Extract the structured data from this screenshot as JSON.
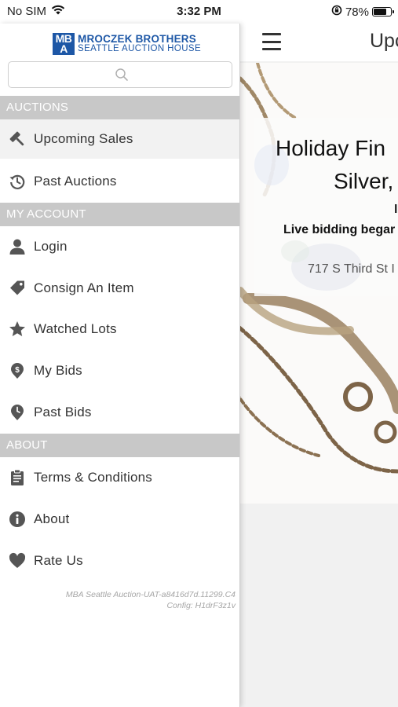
{
  "status_bar": {
    "carrier": "No SIM",
    "time": "3:32 PM",
    "battery_percent": "78%",
    "battery_level": 0.78,
    "icons": [
      "wifi-icon",
      "orientation-lock-icon",
      "battery-icon"
    ]
  },
  "drawer": {
    "logo": {
      "mark": "MBA",
      "line1": "MROCZEK BROTHERS",
      "line2": "SEATTLE AUCTION HOUSE"
    },
    "search": {
      "value": "",
      "placeholder": ""
    },
    "sections": {
      "auctions": "AUCTIONS",
      "my_account": "MY ACCOUNT",
      "about": "ABOUT"
    },
    "items": [
      {
        "label": "Upcoming Sales",
        "icon": "gavel-icon",
        "active": true
      },
      {
        "label": "Past Auctions",
        "icon": "history-icon",
        "active": false
      },
      {
        "label": "Login",
        "icon": "user-icon",
        "active": false
      },
      {
        "label": "Consign An Item",
        "icon": "tag-icon",
        "active": false
      },
      {
        "label": "Watched Lots",
        "icon": "star-icon",
        "active": false
      },
      {
        "label": "My Bids",
        "icon": "dollar-pin-icon",
        "active": false
      },
      {
        "label": "Past Bids",
        "icon": "clock-pin-icon",
        "active": false
      },
      {
        "label": "Terms & Conditions",
        "icon": "clipboard-icon",
        "active": false
      },
      {
        "label": "About",
        "icon": "info-icon",
        "active": false
      },
      {
        "label": "Rate Us",
        "icon": "heart-icon",
        "active": false
      }
    ],
    "version_line1": "MBA Seattle Auction-UAT-a8416d7d.11299.C4",
    "version_line2": "Config: H1drF3z1v"
  },
  "main": {
    "title": "Upc",
    "sale": {
      "title_line1": "Holiday Fin",
      "title_line2": "Silver,",
      "date": "I",
      "live_text": "Live bidding begar",
      "address": "717 S Third St I"
    }
  },
  "colors": {
    "brand_blue": "#1d57a6",
    "section_gray": "#c8c8c8",
    "active_bg": "#f2f2f2",
    "icon_gray": "#555555"
  }
}
